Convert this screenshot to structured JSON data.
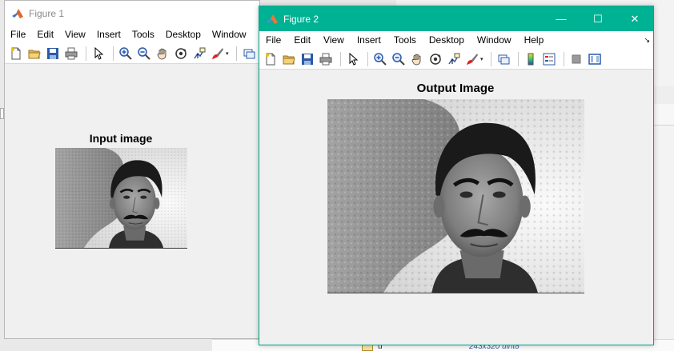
{
  "figure1": {
    "title": "Figure 1",
    "menu": [
      "File",
      "Edit",
      "View",
      "Insert",
      "Tools",
      "Desktop",
      "Window"
    ],
    "plot_title": "Input image"
  },
  "figure2": {
    "title": "Figure 2",
    "menu": [
      "File",
      "Edit",
      "View",
      "Insert",
      "Tools",
      "Desktop",
      "Window",
      "Help"
    ],
    "plot_title": "Output Image",
    "window_buttons": {
      "minimize": "—",
      "maximize": "☐",
      "close": "✕"
    }
  },
  "background": {
    "variable_name": "u",
    "variable_value": "243x320 uint8"
  },
  "colors": {
    "figure2_titlebar": "#00b294",
    "window_bg": "#f0f0f0"
  }
}
